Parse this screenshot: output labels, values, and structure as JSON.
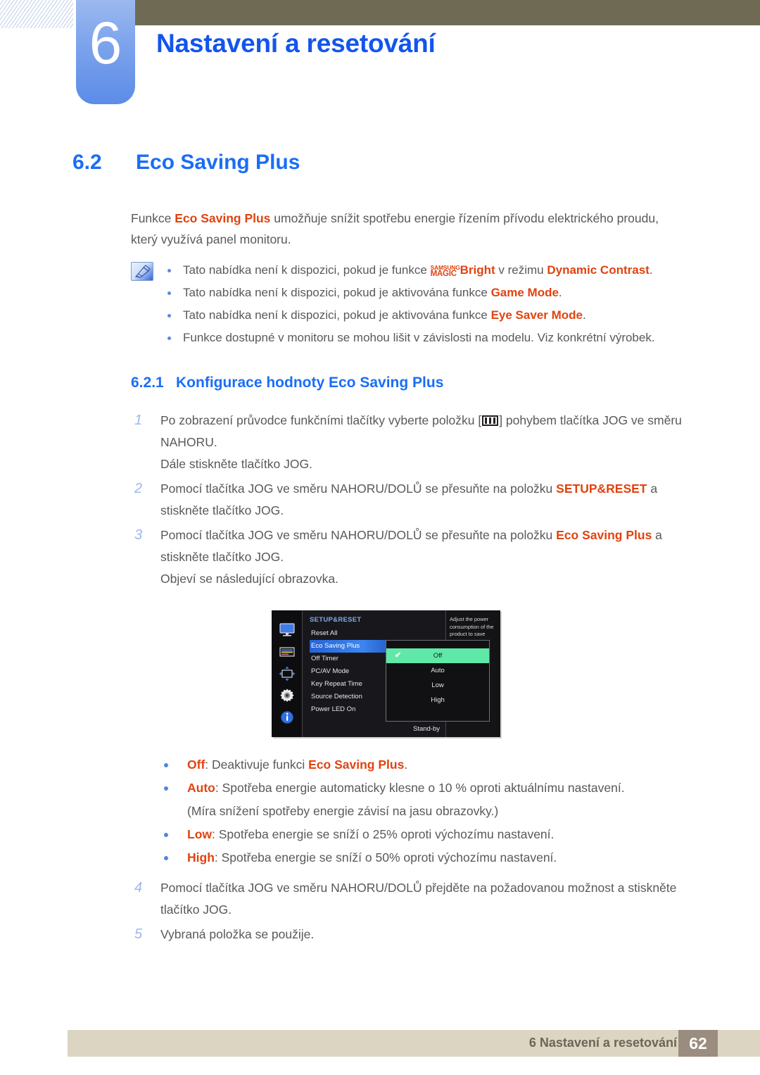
{
  "header": {
    "chapter_number": "6",
    "chapter_title": "Nastavení a resetování"
  },
  "section": {
    "number": "6.2",
    "title": "Eco Saving Plus"
  },
  "intro": {
    "p1_a": "Funkce ",
    "p1_b": "Eco Saving Plus",
    "p1_c": " umožňuje snížit spotřebu energie řízením přívodu elektrického proudu, který využívá panel monitoru."
  },
  "note": {
    "icon": "note-pencil-icon",
    "items": [
      {
        "a": "Tato nabídka není k dispozici, pokud je funkce ",
        "magic_top": "SAMSUNG",
        "magic_bottom": "MAGIC",
        "b": "Bright",
        "c": " v režimu ",
        "d": "Dynamic Contrast",
        "e": "."
      },
      {
        "a": "Tato nabídka není k dispozici, pokud je aktivována funkce ",
        "b": "Game Mode",
        "c": "."
      },
      {
        "a": "Tato nabídka není k dispozici, pokud je aktivována funkce ",
        "b": "Eye Saver Mode",
        "c": "."
      },
      {
        "a": "Funkce dostupné v monitoru se mohou lišit v závislosti na modelu. Viz konkrétní výrobek.",
        "b": "",
        "c": ""
      }
    ]
  },
  "subsection": {
    "number": "6.2.1",
    "title": "Konfigurace hodnoty Eco Saving Plus"
  },
  "steps": {
    "s1": {
      "num": "1",
      "a": "Po zobrazení průvodce funkčními tlačítky vyberte položku [",
      "icon": "menu-bars-icon",
      "b": "] pohybem tlačítka JOG ve směru NAHORU.",
      "sub": "Dále stiskněte tlačítko JOG."
    },
    "s2": {
      "num": "2",
      "a": "Pomocí tlačítka JOG ve směru NAHORU/DOLŮ se přesuňte na položku ",
      "hl": "SETUP&RESET",
      "b": " a stiskněte tlačítko JOG."
    },
    "s3": {
      "num": "3",
      "a": "Pomocí tlačítka JOG ve směru NAHORU/DOLŮ se přesuňte na položku ",
      "hl": "Eco Saving Plus",
      "b": " a stiskněte tlačítko JOG.",
      "sub": "Objeví se následující obrazovka."
    },
    "s4": {
      "num": "4",
      "a": "Pomocí tlačítka JOG ve směru NAHORU/DOLŮ přejděte na požadovanou možnost a stiskněte tlačítko JOG."
    },
    "s5": {
      "num": "5",
      "a": "Vybraná položka se použije."
    }
  },
  "osd": {
    "rail_icons": [
      "monitor-icon",
      "color-bars-icon",
      "resize-arrows-icon",
      "gear-icon",
      "info-icon"
    ],
    "title": "SETUP&RESET",
    "menu_items": [
      "Reset All",
      "Eco Saving Plus",
      "Off Timer",
      "PC/AV Mode",
      "Key Repeat Time",
      "Source Detection",
      "Power LED On"
    ],
    "selected_item": "Eco Saving Plus",
    "standby_value": "Stand-by",
    "submenu_options": [
      "Off",
      "Auto",
      "Low",
      "High"
    ],
    "submenu_selected": "Off",
    "check_glyph": "✔",
    "help_text": "Adjust the power consumption of the product to save energy.",
    "colors": {
      "selected_row": "#3d86f0",
      "submenu_highlight": "#5fe8a8",
      "title_blue": "#7fa9f2"
    }
  },
  "options": [
    {
      "label": "Off",
      "a": ": Deaktivuje funkci ",
      "hl": "Eco Saving Plus",
      "b": "."
    },
    {
      "label": "Auto",
      "a": ": Spotřeba energie automaticky klesne o 10 % oproti aktuálnímu nastavení.",
      "hl": "",
      "b": ""
    },
    {
      "label": "",
      "a": "(Míra snížení spotřeby energie závisí na jasu obrazovky.)",
      "hl": "",
      "b": ""
    },
    {
      "label": "Low",
      "a": ": Spotřeba energie se sníží o 25% oproti výchozímu nastavení.",
      "hl": "",
      "b": ""
    },
    {
      "label": "High",
      "a": ": Spotřeba energie se sníží o 50% oproti výchozímu nastavení.",
      "hl": "",
      "b": ""
    }
  ],
  "footer": {
    "text": "6 Nastavení a resetování",
    "page": "62"
  }
}
